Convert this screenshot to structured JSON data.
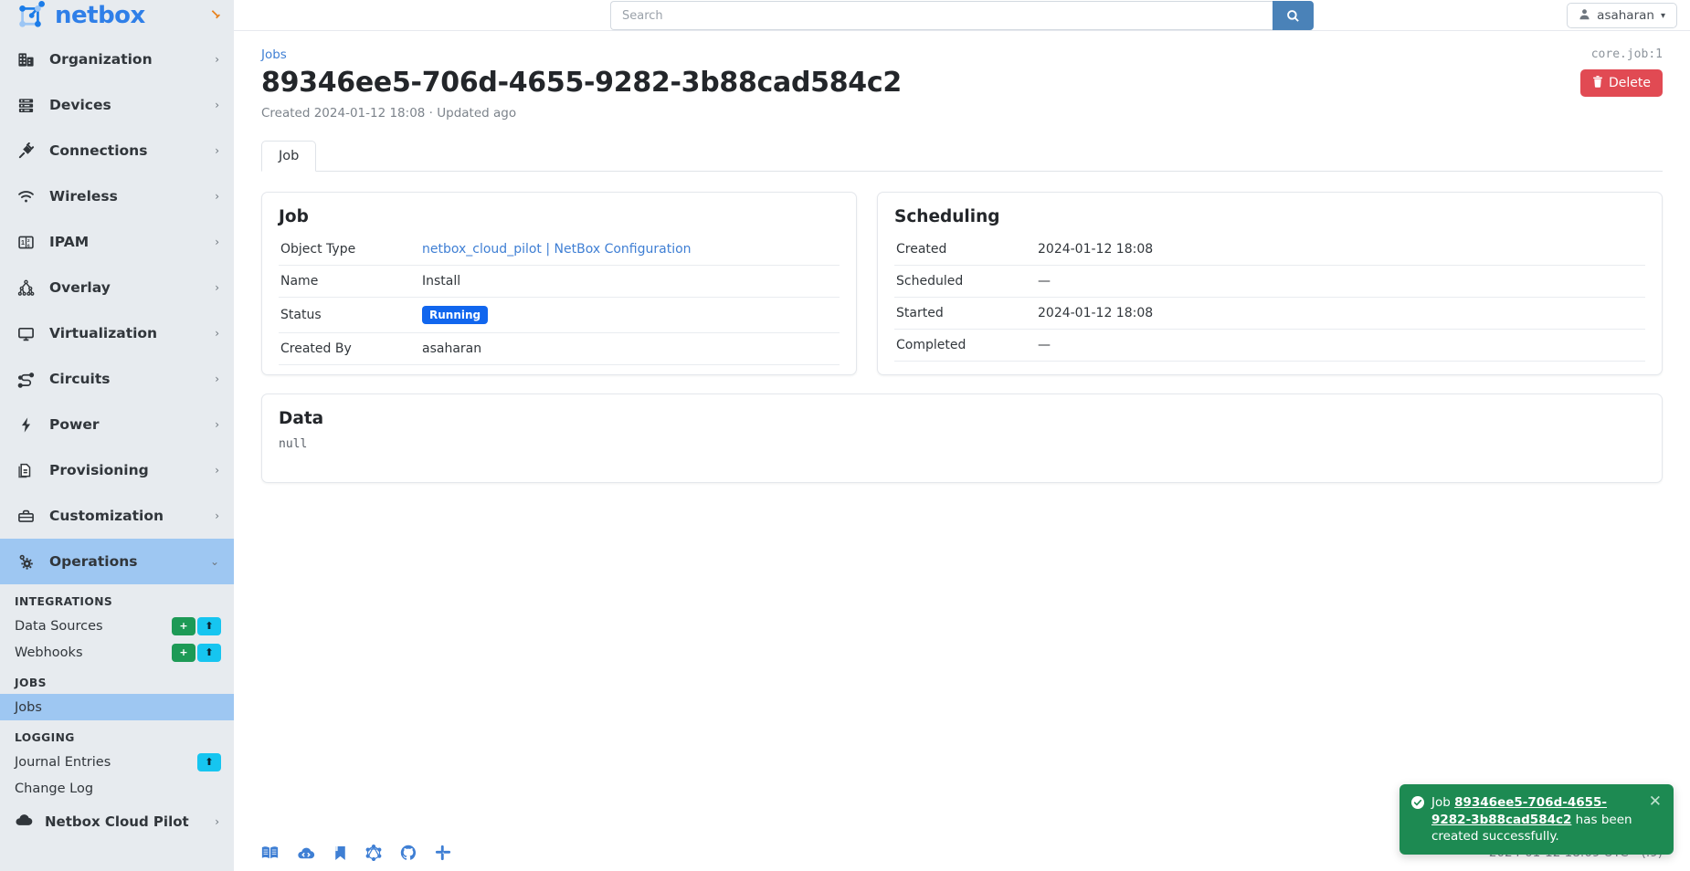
{
  "brand": {
    "name": "netbox",
    "pin_icon": "pin-icon"
  },
  "search": {
    "placeholder": "Search",
    "value": "",
    "button_icon": "search-icon"
  },
  "user": {
    "name": "asaharan",
    "icon": "user-icon",
    "caret": "▾"
  },
  "sidebar": {
    "groups": [
      {
        "label": "Organization",
        "icon": "building-icon",
        "chevron": "›",
        "active": false
      },
      {
        "label": "Devices",
        "icon": "server-icon",
        "chevron": "›",
        "active": false
      },
      {
        "label": "Connections",
        "icon": "plug-icon",
        "chevron": "›",
        "active": false
      },
      {
        "label": "Wireless",
        "icon": "wifi-icon",
        "chevron": "›",
        "active": false
      },
      {
        "label": "IPAM",
        "icon": "numbers-icon",
        "chevron": "›",
        "active": false
      },
      {
        "label": "Overlay",
        "icon": "hierarchy-icon",
        "chevron": "›",
        "active": false
      },
      {
        "label": "Virtualization",
        "icon": "monitor-icon",
        "chevron": "›",
        "active": false
      },
      {
        "label": "Circuits",
        "icon": "circuit-icon",
        "chevron": "›",
        "active": false
      },
      {
        "label": "Power",
        "icon": "bolt-icon",
        "chevron": "›",
        "active": false
      },
      {
        "label": "Provisioning",
        "icon": "documents-icon",
        "chevron": "›",
        "active": false
      },
      {
        "label": "Customization",
        "icon": "toolbox-icon",
        "chevron": "›",
        "active": false
      },
      {
        "label": "Operations",
        "icon": "gears-icon",
        "chevron": "⌄",
        "active": true
      }
    ],
    "sections": [
      {
        "title": "INTEGRATIONS",
        "items": [
          {
            "label": "Data Sources",
            "active": false,
            "buttons": [
              "+",
              "⬆"
            ]
          },
          {
            "label": "Webhooks",
            "active": false,
            "buttons": [
              "+",
              "⬆"
            ]
          }
        ]
      },
      {
        "title": "JOBS",
        "items": [
          {
            "label": "Jobs",
            "active": true,
            "buttons": []
          }
        ]
      },
      {
        "title": "LOGGING",
        "items": [
          {
            "label": "Journal Entries",
            "active": false,
            "buttons": [
              "⬆"
            ]
          },
          {
            "label": "Change Log",
            "active": false,
            "buttons": []
          }
        ]
      }
    ],
    "cloud_pilot": {
      "label": "Netbox Cloud Pilot",
      "icon": "cloud-icon",
      "chevron": "›"
    }
  },
  "page": {
    "breadcrumb": "Jobs",
    "object_id": "core.job:1",
    "title": "89346ee5-706d-4655-9282-3b88cad584c2",
    "meta": "Created 2024-01-12 18:08 · Updated ago",
    "delete_label": "Delete",
    "delete_icon": "trash-icon",
    "delete_color": "#e14a53",
    "tabs": [
      {
        "label": "Job",
        "active": true
      }
    ]
  },
  "job_card": {
    "title": "Job",
    "rows": [
      {
        "key": "Object Type",
        "value": "netbox_cloud_pilot | NetBox Configuration",
        "type": "link"
      },
      {
        "key": "Name",
        "value": "Install",
        "type": "text"
      },
      {
        "key": "Status",
        "value": "Running",
        "type": "badge",
        "badge_color": "#1166ee"
      },
      {
        "key": "Created By",
        "value": "asaharan",
        "type": "text"
      }
    ]
  },
  "scheduling_card": {
    "title": "Scheduling",
    "rows": [
      {
        "key": "Created",
        "value": "2024-01-12 18:08"
      },
      {
        "key": "Scheduled",
        "value": "—"
      },
      {
        "key": "Started",
        "value": "2024-01-12 18:08"
      },
      {
        "key": "Completed",
        "value": "—"
      }
    ]
  },
  "data_card": {
    "title": "Data",
    "value": "null"
  },
  "footer": {
    "icons": [
      "docs-book-icon",
      "api-cloud-icon",
      "bookmark-icon",
      "graphql-icon",
      "github-icon",
      "slack-icon"
    ],
    "timestamp": "2024-01-12 18:09 UTC",
    "version": "(.9)"
  },
  "toast": {
    "icon": "check-circle-icon",
    "prefix": "Job ",
    "link": "89346ee5-706d-4655-9282-3b88cad584c2",
    "suffix": " has been created successfully.",
    "close_icon": "close-icon",
    "color": "#1d8a52"
  }
}
